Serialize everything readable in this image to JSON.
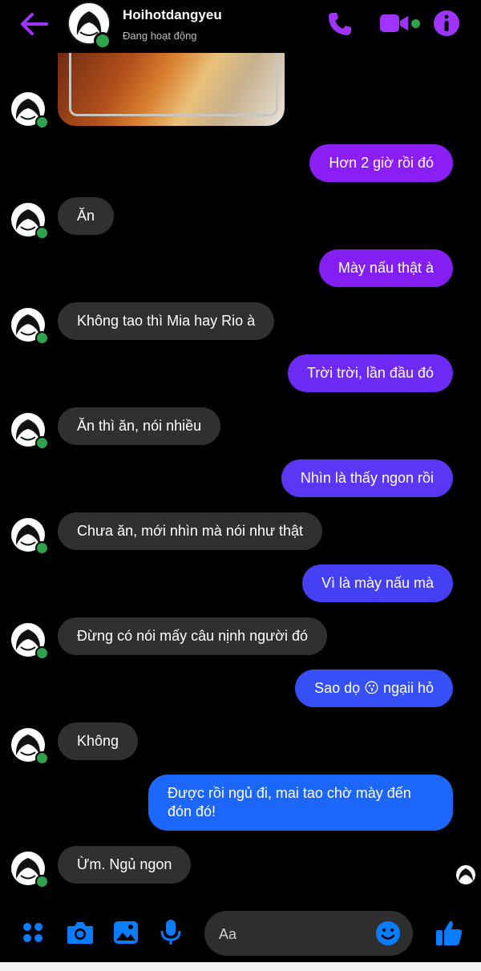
{
  "header": {
    "contact_name": "Hoihotdangyeu",
    "status": "Đang hoạt động"
  },
  "messages": [
    {
      "side": "in",
      "text": "Ăn"
    },
    {
      "side": "out",
      "text": "Hơn 2 giờ rồi đó"
    },
    {
      "side": "out",
      "text": "Mày nấu thật à"
    },
    {
      "side": "in",
      "text": "Không tao thì Mia hay Rio à"
    },
    {
      "side": "out",
      "text": "Trời trời, lần đầu đó"
    },
    {
      "side": "in",
      "text": "Ăn thì ăn, nói nhiều"
    },
    {
      "side": "out",
      "text": "Nhìn là thấy ngon rồi"
    },
    {
      "side": "in",
      "text": "Chưa ăn, mới nhìn mà nói như thật"
    },
    {
      "side": "out",
      "text": "Vì là mày nấu mà"
    },
    {
      "side": "in",
      "text": "Đừng có nói mấy câu nịnh người đó"
    },
    {
      "side": "out",
      "text": "Sao dọ 😗 ngạii hỏ"
    },
    {
      "side": "in",
      "text": "Không"
    },
    {
      "side": "out",
      "text": "Được rồi ngủ đi, mai tao chờ mày đến đón đó!"
    },
    {
      "side": "in",
      "text": "Ừm. Ngủ ngon"
    }
  ],
  "composer": {
    "placeholder": "Aa"
  },
  "icons": {
    "back": "back-arrow-icon",
    "call": "phone-icon",
    "video": "video-camera-icon",
    "info": "info-icon",
    "menu": "four-dots-icon",
    "camera": "camera-icon",
    "gallery": "image-icon",
    "voice": "microphone-icon",
    "emoji": "emoji-icon",
    "like": "thumbs-up-icon"
  },
  "colors": {
    "accent": "#a033ff",
    "composer_accent": "#0a7cff",
    "incoming_bubble": "#303030",
    "outgoing_gradient_top": "#8a1cf5",
    "outgoing_gradient_bottom": "#1a6bff",
    "online": "#31a24c"
  }
}
